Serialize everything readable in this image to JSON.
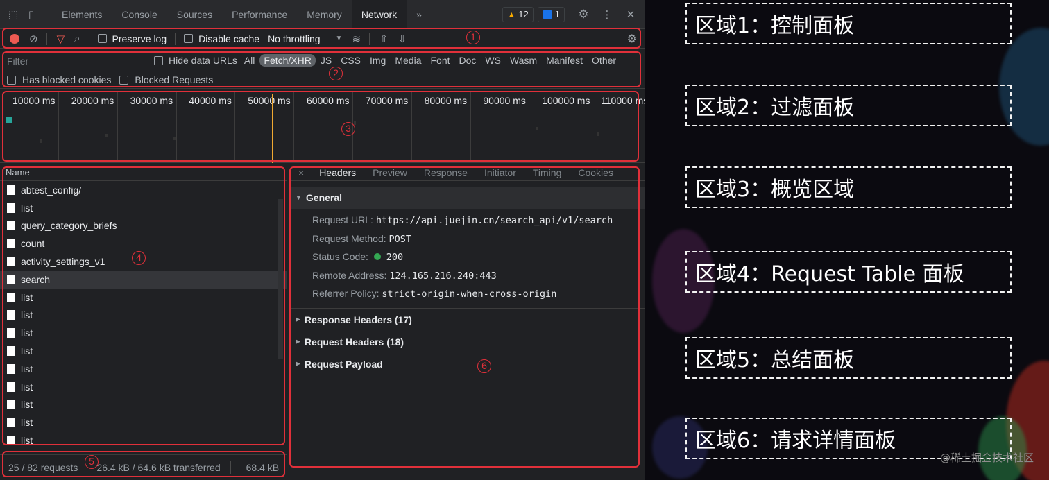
{
  "tabbar": {
    "tabs": [
      "Elements",
      "Console",
      "Sources",
      "Performance",
      "Memory",
      "Network"
    ],
    "active_tab": "Network",
    "more": "»",
    "warnings_count": "12",
    "messages_count": "1",
    "close": "✕"
  },
  "toolbar": {
    "preserve_log": "Preserve log",
    "disable_cache": "Disable cache",
    "throttling": "No throttling",
    "throttling_arrow": "▼"
  },
  "filter": {
    "placeholder": "Filter",
    "hide_data_urls": "Hide data URLs",
    "types": [
      "All",
      "Fetch/XHR",
      "JS",
      "CSS",
      "Img",
      "Media",
      "Font",
      "Doc",
      "WS",
      "Wasm",
      "Manifest",
      "Other"
    ],
    "active_type": "Fetch/XHR",
    "has_blocked_cookies": "Has blocked cookies",
    "blocked_requests": "Blocked Requests"
  },
  "overview": {
    "ticks": [
      "10000 ms",
      "20000 ms",
      "30000 ms",
      "40000 ms",
      "50000 ms",
      "60000 ms",
      "70000 ms",
      "80000 ms",
      "90000 ms",
      "100000 ms",
      "110000 ms"
    ]
  },
  "request_table": {
    "header": "Name",
    "rows": [
      "abtest_config/",
      "list",
      "query_category_briefs",
      "count",
      "activity_settings_v1",
      "search",
      "list",
      "list",
      "list",
      "list",
      "list",
      "list",
      "list",
      "list",
      "list"
    ],
    "selected": "search"
  },
  "summary": {
    "requests": "25 / 82 requests",
    "transferred": "26.4 kB / 64.6 kB transferred",
    "resources": "68.4 kB"
  },
  "details": {
    "close": "×",
    "tabs": [
      "Headers",
      "Preview",
      "Response",
      "Initiator",
      "Timing",
      "Cookies"
    ],
    "active_tab": "Headers",
    "general_title": "General",
    "request_url_label": "Request URL:",
    "request_url_value": "https://api.juejin.cn/search_api/v1/search",
    "request_method_label": "Request Method:",
    "request_method_value": "POST",
    "status_code_label": "Status Code:",
    "status_code_value": "200",
    "remote_address_label": "Remote Address:",
    "remote_address_value": "124.165.216.240:443",
    "referrer_policy_label": "Referrer Policy:",
    "referrer_policy_value": "strict-origin-when-cross-origin",
    "response_headers": "Response Headers (17)",
    "request_headers": "Request Headers (18)",
    "request_payload": "Request Payload"
  },
  "annotations": {
    "numbers": [
      "1",
      "2",
      "3",
      "4",
      "5",
      "6"
    ],
    "box_color": "#e0303a"
  },
  "legend": [
    "区域1：控制面板",
    "区域2：过滤面板",
    "区域3：概览区域",
    "区域4：Request Table 面板",
    "区域5：总结面板",
    "区域6：请求详情面板"
  ],
  "watermark": "@稀土掘金技术社区"
}
